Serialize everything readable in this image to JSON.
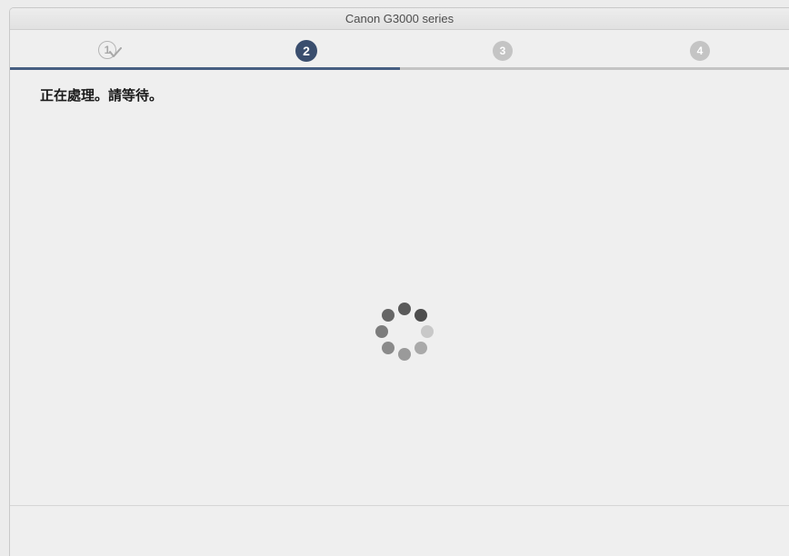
{
  "window": {
    "title": "Canon G3000 series"
  },
  "steps": [
    {
      "label": "1",
      "state": "completed",
      "icon": "step-1-completed-check-icon"
    },
    {
      "label": "2",
      "state": "active",
      "icon": "step-2-active-icon"
    },
    {
      "label": "3",
      "state": "pending",
      "icon": "step-3-pending-icon"
    },
    {
      "label": "4",
      "state": "pending",
      "icon": "step-4-pending-icon"
    }
  ],
  "progress": {
    "fraction": 0.5
  },
  "main": {
    "message": "正在處理。請等待。"
  },
  "spinner": {
    "icon": "loading-spinner-icon"
  },
  "colors": {
    "active_step": "#3a4e6e",
    "progress_fill": "#475f82",
    "pending_step": "#c4c4c4"
  }
}
